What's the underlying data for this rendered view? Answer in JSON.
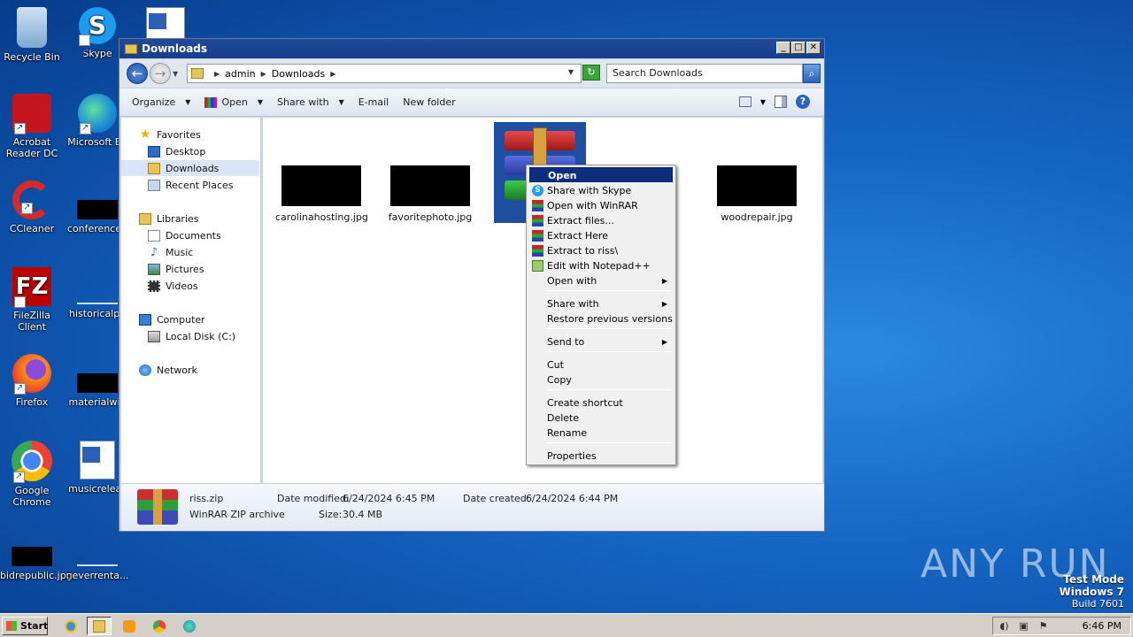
{
  "desktop": {
    "icons": [
      {
        "label": "Recycle Bin"
      },
      {
        "label": "Skype"
      },
      {
        "label": "Acrobat Reader DC"
      },
      {
        "label": "Microsoft Ed"
      },
      {
        "label": "CCleaner"
      },
      {
        "label": "conferenced"
      },
      {
        "label": "FileZilla Client"
      },
      {
        "label": "historicalpa"
      },
      {
        "label": "Firefox"
      },
      {
        "label": "materialwin"
      },
      {
        "label": "Google Chrome"
      },
      {
        "label": "musicreleas"
      },
      {
        "label": "bidrepublic.jpg"
      },
      {
        "label": "neverrenta..."
      }
    ]
  },
  "window": {
    "title": "Downloads",
    "address": {
      "crumbs": [
        "admin",
        "Downloads"
      ]
    },
    "search_placeholder": "Search Downloads",
    "toolbar": {
      "organize": "Organize",
      "open": "Open",
      "share_with": "Share with",
      "email": "E-mail",
      "new_folder": "New folder"
    },
    "nav": {
      "favorites": "Favorites",
      "desktop": "Desktop",
      "downloads": "Downloads",
      "recent_places": "Recent Places",
      "libraries": "Libraries",
      "documents": "Documents",
      "music": "Music",
      "pictures": "Pictures",
      "videos": "Videos",
      "computer": "Computer",
      "local_disk": "Local Disk (C:)",
      "network": "Network"
    },
    "files": [
      {
        "name": "carolinahosting.jpg"
      },
      {
        "name": "favoritephoto.jpg"
      },
      {
        "name": "r"
      },
      {
        "name": "pg"
      },
      {
        "name": "woodrepair.jpg"
      }
    ],
    "details": {
      "name": "riss.zip",
      "type": "WinRAR ZIP archive",
      "modified_label": "Date modified:",
      "modified": "6/24/2024 6:45 PM",
      "created_label": "Date created:",
      "created": "6/24/2024 6:44 PM",
      "size_label": "Size:",
      "size": "30.4 MB"
    }
  },
  "context_menu": {
    "items": [
      "Open",
      "Share with Skype",
      "Open with WinRAR",
      "Extract files...",
      "Extract Here",
      "Extract to riss\\",
      "Edit with Notepad++",
      "Open with",
      "Share with",
      "Restore previous versions",
      "Send to",
      "Cut",
      "Copy",
      "Create shortcut",
      "Delete",
      "Rename",
      "Properties"
    ]
  },
  "taskbar": {
    "start": "Start",
    "clock": "6:46 PM"
  },
  "watermark": {
    "line1": "Test Mode",
    "line2": "Windows 7",
    "line3": "Build 7601",
    "brand": "ANY RUN"
  }
}
